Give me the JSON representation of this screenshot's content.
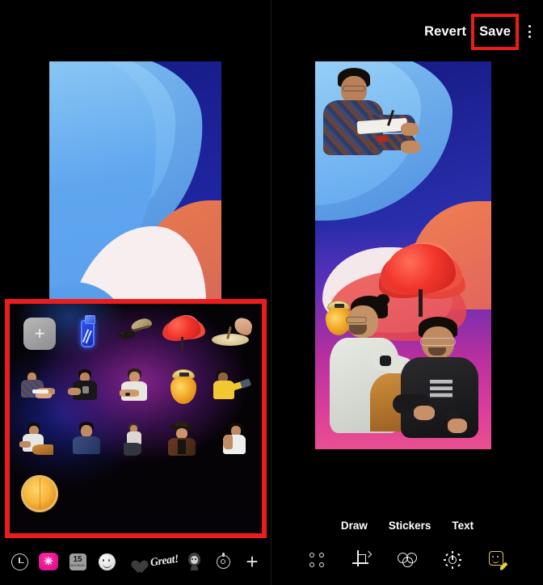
{
  "app": {
    "left_panel_name": "sticker-picker-screen",
    "right_panel_name": "photo-editor-screen"
  },
  "editor_header": {
    "revert_label": "Revert",
    "save_label": "Save",
    "overflow_menu_label": "More options"
  },
  "highlights": {
    "color": "#ed1c1c",
    "save_button_highlight": true,
    "sticker_tray_highlight": true
  },
  "sticker_tray": {
    "add_label": "+",
    "items": [
      {
        "name": "add-new-sticker",
        "kind": "add"
      },
      {
        "name": "blue-bottle-sticker",
        "kind": "bottle"
      },
      {
        "name": "bird-on-branch-sticker",
        "kind": "bird"
      },
      {
        "name": "red-tree-sticker",
        "kind": "tree"
      },
      {
        "name": "hand-with-plate-sticker",
        "kind": "plate"
      },
      {
        "name": "man-plaid-shirt-sticker",
        "kind": "person",
        "variant": "plaid"
      },
      {
        "name": "man-black-tshirt-sticker",
        "kind": "person",
        "variant": "black"
      },
      {
        "name": "man-white-tshirt-sticker",
        "kind": "person",
        "variant": "white"
      },
      {
        "name": "spice-jar-sticker",
        "kind": "jar"
      },
      {
        "name": "man-yellow-shirt-sticker",
        "kind": "person",
        "variant": "yellow"
      },
      {
        "name": "man-seated-chair-sticker",
        "kind": "person",
        "variant": "seated"
      },
      {
        "name": "man-blue-shirt-sticker",
        "kind": "person",
        "variant": "blue"
      },
      {
        "name": "man-sitting-sticker",
        "kind": "person",
        "variant": "sitting"
      },
      {
        "name": "man-cowboy-hat-sticker",
        "kind": "person",
        "variant": "cowboy"
      },
      {
        "name": "man-hand-up-sticker",
        "kind": "person",
        "variant": "handup"
      },
      {
        "name": "pizza-sticker",
        "kind": "pizza"
      }
    ]
  },
  "sticker_bottom_bar": {
    "items": [
      {
        "name": "recent-icon",
        "label": "Recent"
      },
      {
        "name": "gif-icon",
        "label": "GIF"
      },
      {
        "name": "calendar-icon",
        "label": "15",
        "sublabel": "SATURDAY"
      },
      {
        "name": "emoji-icon",
        "label": "Emoji"
      },
      {
        "name": "heart-sticker-icon",
        "label": "Hearts"
      },
      {
        "name": "script-text-icon",
        "label": "Great!"
      },
      {
        "name": "avatar-sticker-icon",
        "label": "Avatar"
      },
      {
        "name": "gear-icon",
        "label": "Settings"
      },
      {
        "name": "add-icon",
        "label": "+"
      }
    ]
  },
  "editor_tabs": [
    {
      "name": "tab-draw",
      "label": "Draw"
    },
    {
      "name": "tab-stickers",
      "label": "Stickers"
    },
    {
      "name": "tab-text",
      "label": "Text"
    }
  ],
  "editor_toolbar": [
    {
      "name": "smart-suggestions-icon",
      "label": "Suggestions",
      "active": false
    },
    {
      "name": "crop-rotate-icon",
      "label": "Crop",
      "active": false
    },
    {
      "name": "filters-icon",
      "label": "Filters",
      "active": false
    },
    {
      "name": "adjust-brightness-icon",
      "label": "Adjust",
      "active": false
    },
    {
      "name": "markup-sticker-icon",
      "label": "Markup",
      "active": true
    }
  ],
  "wallpaper_preview": {
    "name": "wallpaper-preview",
    "colors": {
      "navy": "#1e2087",
      "light_blue": "#6badf0",
      "pale_blue": "#9ad2f6",
      "cream": "#f7eef0",
      "orange": "#e0704f"
    }
  },
  "edited_photo": {
    "name": "edited-photo-canvas",
    "applied_stickers": [
      {
        "name": "man-plaid-shirt-sticker"
      },
      {
        "name": "red-tree-sticker"
      },
      {
        "name": "spice-jar-sticker"
      }
    ],
    "background_colors": {
      "navy": "#1e2087",
      "magenta": "#d0359b",
      "pink": "#e84f8f",
      "orange": "#ef7f50"
    }
  }
}
